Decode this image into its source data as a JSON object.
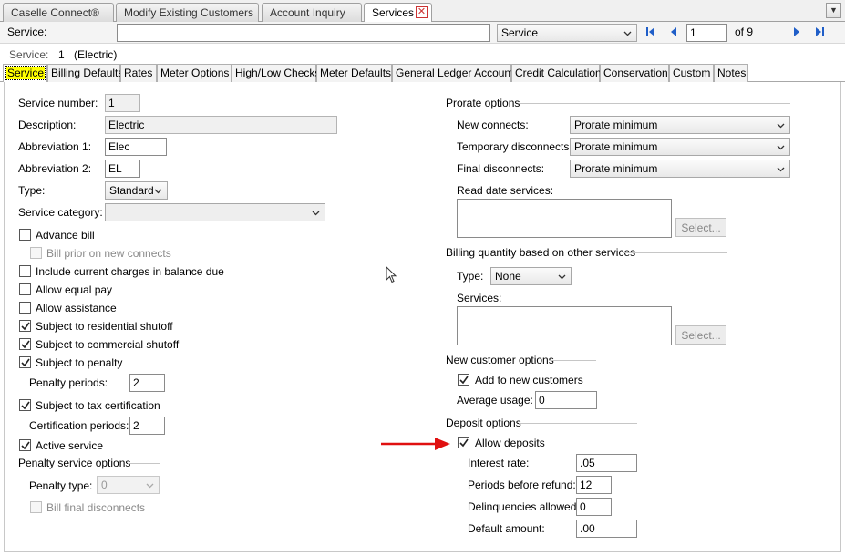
{
  "doc_tabs": [
    "Caselle Connect®",
    "Modify Existing Customers",
    "Account Inquiry",
    "Services"
  ],
  "service_bar": {
    "label": "Service:",
    "input_value": "",
    "search_field": "Service",
    "record": "1",
    "of_label": "of 9"
  },
  "service_info": {
    "label": "Service:",
    "number": "1",
    "name": "(Electric)"
  },
  "sub_tabs": [
    "Service",
    "Billing Defaults",
    "Rates",
    "Meter Options",
    "High/Low Checks",
    "Meter Defaults",
    "General Ledger Accounts",
    "Credit Calculation",
    "Conservation",
    "Custom",
    "Notes"
  ],
  "left": {
    "service_number_label": "Service number:",
    "service_number": "1",
    "description_label": "Description:",
    "description": "Electric",
    "abbrev1_label": "Abbreviation 1:",
    "abbrev1": "Elec",
    "abbrev2_label": "Abbreviation 2:",
    "abbrev2": "EL",
    "type_label": "Type:",
    "type": "Standard",
    "category_label": "Service category:",
    "category": "",
    "advance_bill": "Advance bill",
    "bill_prior": "Bill prior on new connects",
    "include_current": "Include current charges in balance due",
    "equal_pay": "Allow equal pay",
    "allow_assistance": "Allow assistance",
    "residential_shutoff": "Subject to residential shutoff",
    "commercial_shutoff": "Subject to commercial shutoff",
    "subject_penalty": "Subject to penalty",
    "penalty_periods_label": "Penalty periods:",
    "penalty_periods": "2",
    "tax_cert": "Subject to tax certification",
    "cert_periods_label": "Certification periods:",
    "cert_periods": "2",
    "active_service": "Active service",
    "penalty_options_label": "Penalty service options",
    "penalty_type_label": "Penalty type:",
    "penalty_type": "0",
    "bill_final": "Bill final disconnects"
  },
  "right": {
    "prorate_label": "Prorate options",
    "new_connects_label": "New connects:",
    "new_connects": "Prorate minimum",
    "temp_disc_label": "Temporary disconnects:",
    "temp_disc": "Prorate minimum",
    "final_disc_label": "Final disconnects:",
    "final_disc": "Prorate minimum",
    "read_date_label": "Read date services:",
    "select_label": "Select...",
    "billing_qty_label": "Billing quantity based on other services",
    "bq_type_label": "Type:",
    "bq_type": "None",
    "services_label": "Services:",
    "new_customer_label": "New customer options",
    "add_new_customers": "Add to new customers",
    "avg_usage_label": "Average usage:",
    "avg_usage": "0",
    "deposit_label": "Deposit options",
    "allow_deposits": "Allow deposits",
    "interest_label": "Interest rate:",
    "interest": ".05",
    "periods_refund_label": "Periods before refund:",
    "periods_refund": "12",
    "delinq_label": "Delinquencies allowed:",
    "delinq": "0",
    "default_amount_label": "Default amount:",
    "default_amount": ".00"
  },
  "colors": {
    "highlight": "#ffff00",
    "arrow": "#e01010",
    "nav_blue": "#1f5ec8"
  }
}
